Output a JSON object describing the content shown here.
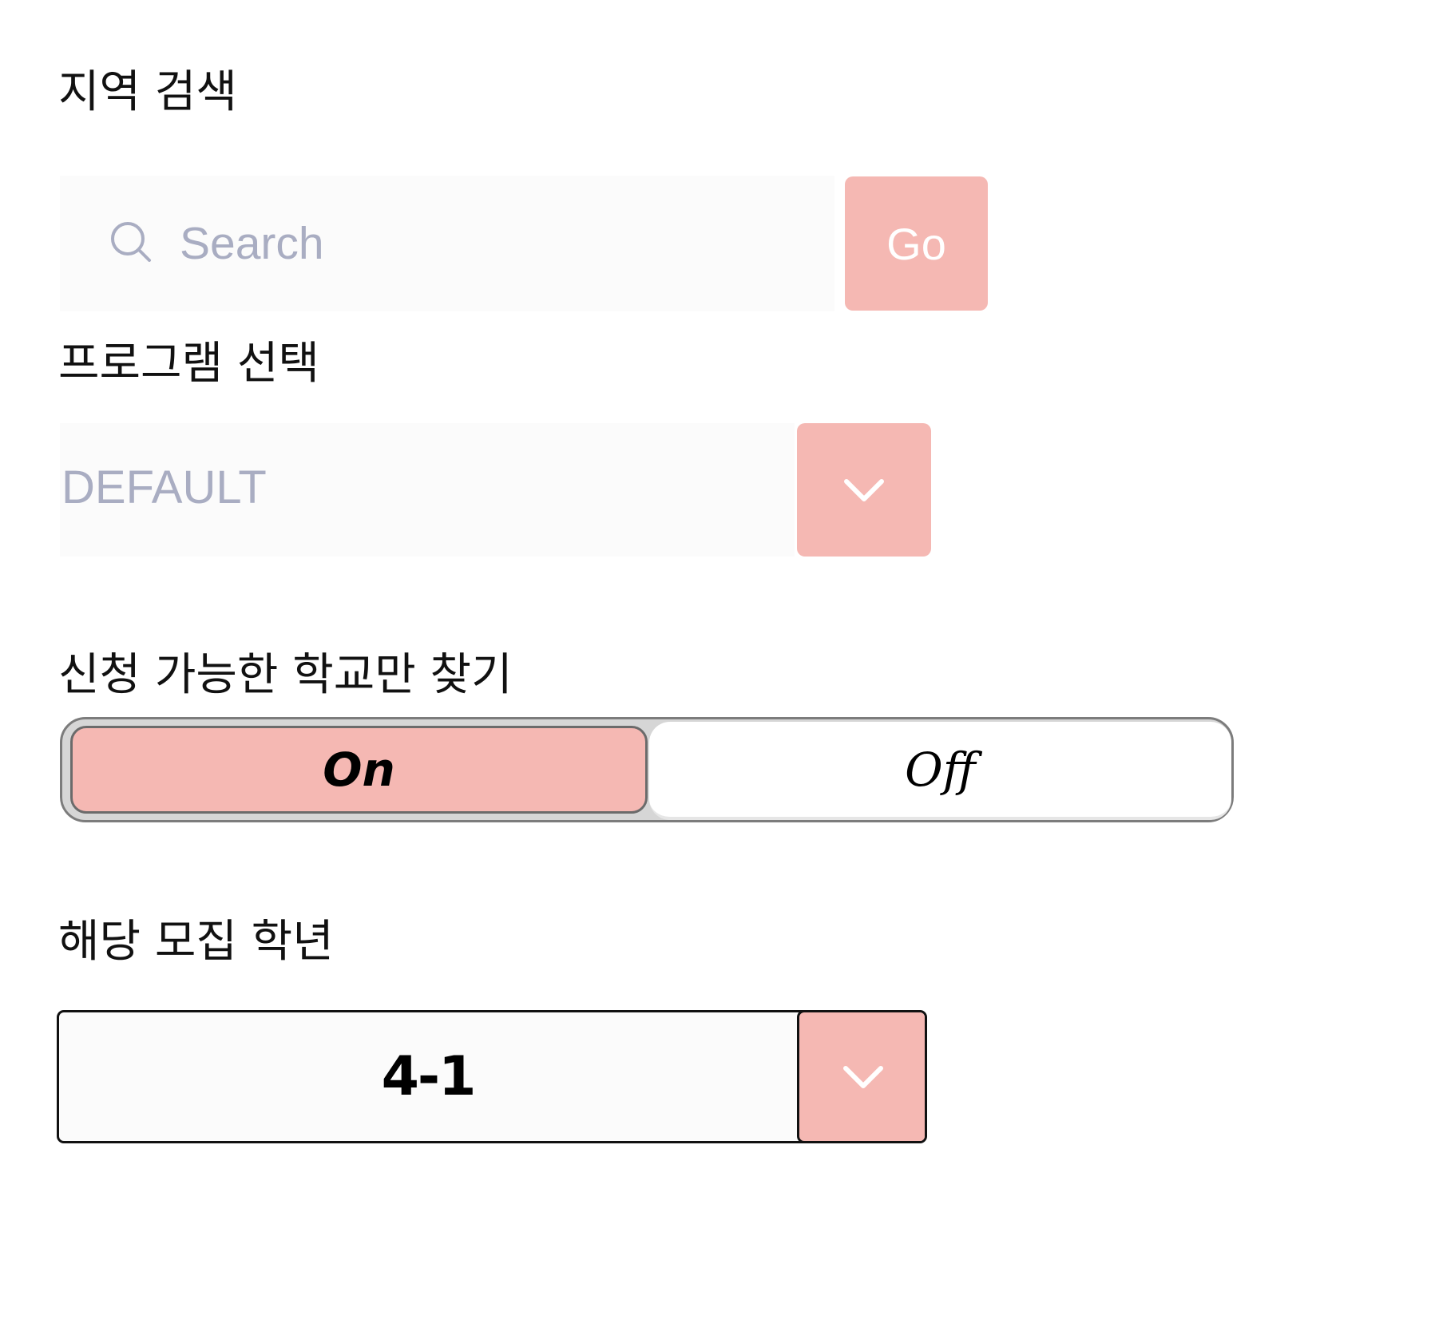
{
  "sections": {
    "region_label": "지역 검색",
    "program_label": "프로그램 선택",
    "available_label": "신청 가능한 학교만 찾기",
    "grade_label": "해당 모집 학년"
  },
  "search": {
    "placeholder": "Search",
    "value": "",
    "go_label": "Go",
    "icon": "search-icon"
  },
  "program_select": {
    "selected": "DEFAULT",
    "icon": "chevron-down-icon"
  },
  "toggle": {
    "on_label": "On",
    "off_label": "Off",
    "selected": "On"
  },
  "grade_select": {
    "selected": "4-1",
    "icon": "chevron-down-icon"
  },
  "colors": {
    "accent": "#f5b8b3",
    "placeholder": "#a9adc2",
    "input_bg": "#fbfbfb",
    "text": "#111111"
  }
}
